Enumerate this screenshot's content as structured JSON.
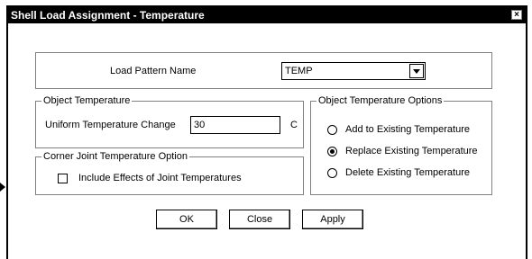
{
  "window": {
    "title": "Shell Load Assignment - Temperature",
    "close_glyph": "×"
  },
  "load_pattern": {
    "label": "Load Pattern Name",
    "selected": "TEMP"
  },
  "object_temperature": {
    "legend": "Object Temperature",
    "change_label": "Uniform Temperature Change",
    "value": "30",
    "unit": "C"
  },
  "corner_joint": {
    "legend": "Corner Joint Temperature Option",
    "checkbox_label": "Include Effects of Joint Temperatures",
    "checked": false
  },
  "options": {
    "legend": "Object Temperature Options",
    "items": [
      {
        "label": "Add to Existing Temperature",
        "selected": false
      },
      {
        "label": "Replace Existing Temperature",
        "selected": true
      },
      {
        "label": "Delete Existing Temperature",
        "selected": false
      }
    ]
  },
  "buttons": {
    "ok": "OK",
    "close": "Close",
    "apply": "Apply"
  }
}
